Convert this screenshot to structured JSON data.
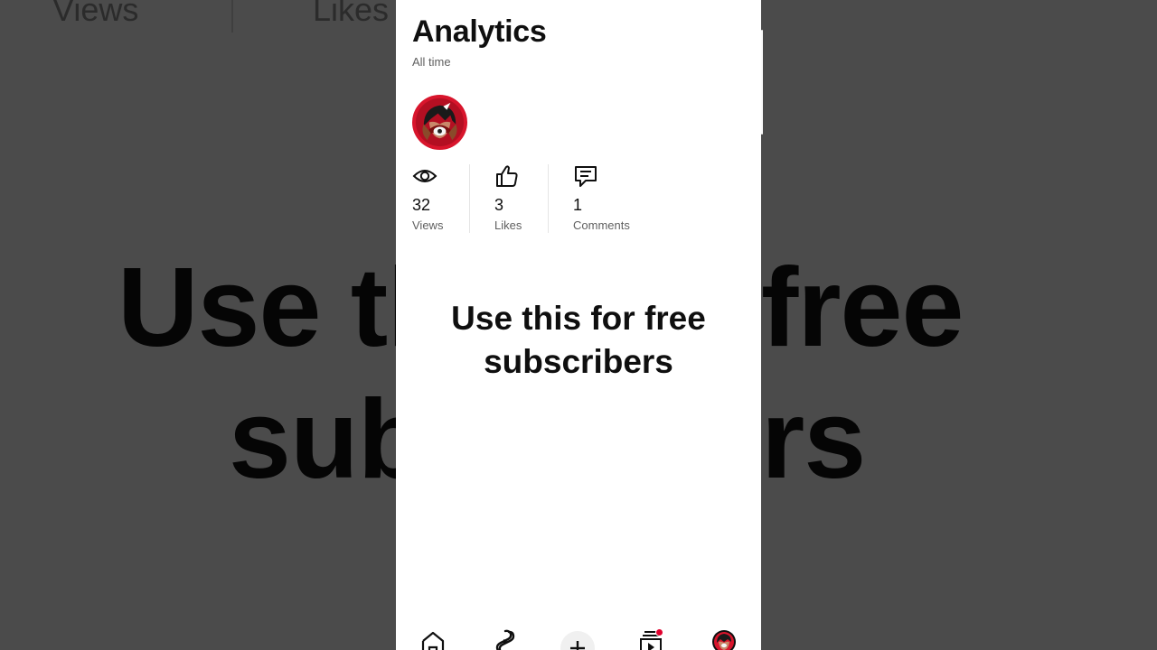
{
  "header": {
    "title": "Analytics",
    "subtitle": "All time"
  },
  "stats": [
    {
      "icon": "eye-icon",
      "value": "32",
      "label": "Views"
    },
    {
      "icon": "thumbs-up-icon",
      "value": "3",
      "label": "Likes"
    },
    {
      "icon": "comment-icon",
      "value": "1",
      "label": "Comments"
    }
  ],
  "caption": {
    "line1": "Use this for free",
    "line2": "subscribers"
  },
  "background": {
    "label_views": "Views",
    "label_likes": "Likes",
    "caption_line1": "Use th",
    "caption_line1_end": "free",
    "caption_line2": "sub",
    "caption_line2_end": "rs"
  },
  "nav": {
    "items": [
      "home-icon",
      "shorts-icon",
      "create-icon",
      "subscriptions-icon",
      "you-avatar-icon"
    ],
    "notification_color": "#e1002d"
  },
  "colors": {
    "accent_red": "#d8152c",
    "text_primary": "#0f0f0f",
    "text_secondary": "#606060"
  }
}
